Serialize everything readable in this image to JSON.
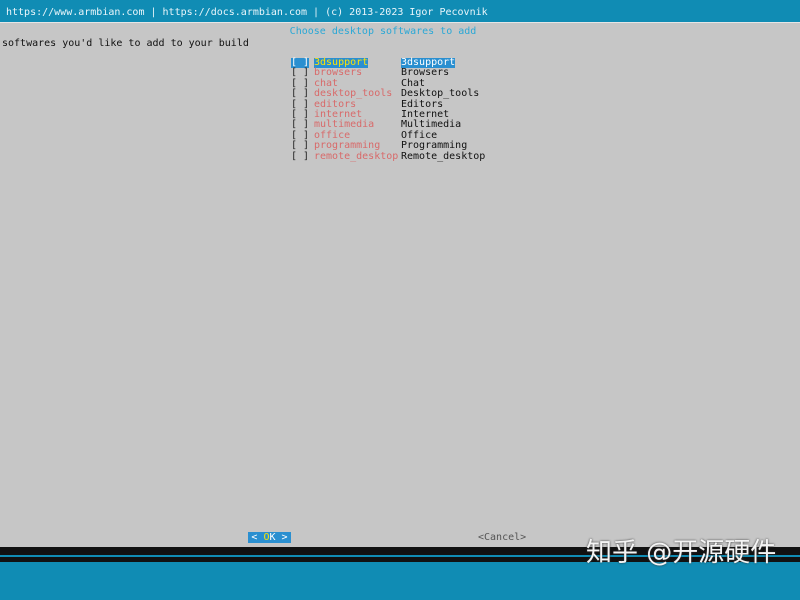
{
  "backtitle": "https://www.armbian.com | https://docs.armbian.com | (c) 2013-2023 Igor Pecovnik",
  "dialog": {
    "title": "Choose desktop softwares to add",
    "prompt": "softwares you'd like to add to your build",
    "items": [
      {
        "checkbox": "[ ]",
        "tag": "3dsupport",
        "desc": "3dsupport",
        "selected": true
      },
      {
        "checkbox": "[ ]",
        "tag": "browsers",
        "desc": "Browsers",
        "selected": false
      },
      {
        "checkbox": "[ ]",
        "tag": "chat",
        "desc": "Chat",
        "selected": false
      },
      {
        "checkbox": "[ ]",
        "tag": "desktop_tools",
        "desc": "Desktop_tools",
        "selected": false
      },
      {
        "checkbox": "[ ]",
        "tag": "editors",
        "desc": "Editors",
        "selected": false
      },
      {
        "checkbox": "[ ]",
        "tag": "internet",
        "desc": "Internet",
        "selected": false
      },
      {
        "checkbox": "[ ]",
        "tag": "multimedia",
        "desc": "Multimedia",
        "selected": false
      },
      {
        "checkbox": "[ ]",
        "tag": "office",
        "desc": "Office",
        "selected": false
      },
      {
        "checkbox": "[ ]",
        "tag": "programming",
        "desc": "Programming",
        "selected": false
      },
      {
        "checkbox": "[ ]",
        "tag": "remote_desktop",
        "desc": "Remote_desktop",
        "selected": false
      }
    ],
    "buttons": {
      "ok_left": "< ",
      "ok_hot": "O",
      "ok_rest": "K",
      "ok_right": " >",
      "cancel": "<Cancel>"
    }
  },
  "watermark": "知乎 @开源硬件",
  "colors": {
    "background": "#108cb4",
    "dialog": "#c6c6c6",
    "highlight": "#2a8fd0",
    "tag": "#d86a6a",
    "title": "#2aa8d6",
    "hotkey": "#ffe400"
  }
}
